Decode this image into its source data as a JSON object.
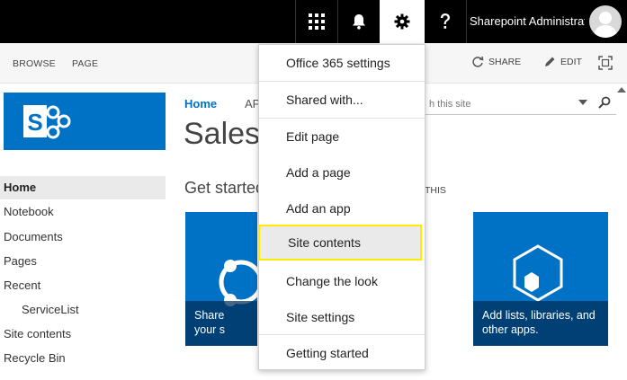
{
  "suitebar": {
    "user_name": "Sharepoint Administrator"
  },
  "ribbon": {
    "tabs": [
      "BROWSE",
      "PAGE"
    ],
    "share_label": "SHARE",
    "edit_label": "EDIT"
  },
  "nav": {
    "items": [
      {
        "label": "Home"
      },
      {
        "label": "Notebook"
      },
      {
        "label": "Documents"
      },
      {
        "label": "Pages"
      },
      {
        "label": "Recent"
      },
      {
        "label": "ServiceList"
      },
      {
        "label": "Site contents"
      },
      {
        "label": "Recycle Bin"
      }
    ]
  },
  "main": {
    "breadcrumb_home": "Home",
    "breadcrumb_next": "AP",
    "title": "Sales",
    "get_started": "Get started",
    "remove_label": "THIS",
    "search_placeholder": "h this site",
    "tile1_caption": "Share your s",
    "tile2_caption": "Add lists, libraries, and other apps."
  },
  "menu": {
    "items": [
      {
        "label": "Office 365 settings"
      },
      {
        "label": "Shared with..."
      },
      {
        "label": "Edit page"
      },
      {
        "label": "Add a page"
      },
      {
        "label": "Add an app"
      },
      {
        "label": "Site contents"
      },
      {
        "label": "Change the look"
      },
      {
        "label": "Site settings"
      },
      {
        "label": "Getting started"
      }
    ]
  },
  "colors": {
    "brand_blue": "#0072c6",
    "highlight": "#ffeb00",
    "suitebar": "#000000"
  }
}
